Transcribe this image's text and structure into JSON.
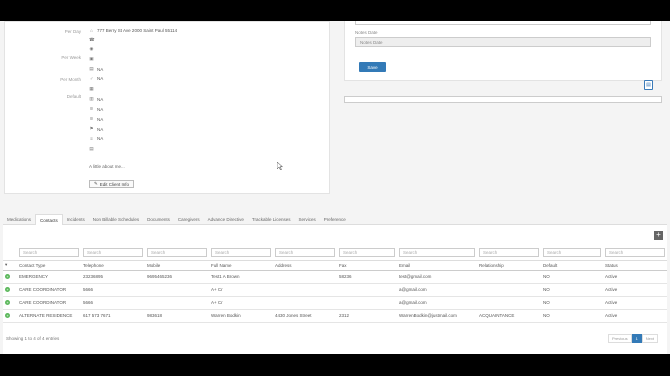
{
  "profile": {
    "labels": [
      "Per Day",
      "Per Week",
      "Per Month",
      "Default"
    ],
    "address": "777 Berry St Ave 2000 Saint Paul 55114",
    "values": [
      "NA",
      "NA",
      "NA",
      "NA",
      "NA",
      "NA",
      "NA"
    ],
    "link": "A little about me...",
    "edit_button": "Edit Client Info"
  },
  "notes": {
    "label": "Notes Date",
    "value": "Notes Date",
    "save_button": "Save"
  },
  "tabs": [
    "Medications",
    "Contacts",
    "Incidents",
    "Non Billable Schedules",
    "Documents",
    "Caregivers",
    "Advance Directive",
    "Trackable Licenses",
    "Services",
    "Preference"
  ],
  "table": {
    "search_placeholder": "Search",
    "columns": [
      "Contact Type",
      "Telephone",
      "Mobile",
      "Full Name",
      "Address",
      "Fax",
      "Email",
      "Relationship",
      "Default",
      "Status"
    ],
    "rows": [
      [
        "EMERGENCY",
        "23236895",
        "9695465236",
        "Test1 A Brown",
        "",
        "58236",
        "test@gmail.com",
        "",
        "NO",
        "Active"
      ],
      [
        "CARE COORDINATOR",
        "5666",
        "",
        "A+ Cr",
        "",
        "",
        "a@gmail.com",
        "",
        "NO",
        "Active"
      ],
      [
        "CARE COORDINATOR",
        "5666",
        "",
        "A+ Cr",
        "",
        "",
        "a@gmail.com",
        "",
        "NO",
        "Active"
      ],
      [
        "ALTERNATE RESIDENCE",
        "617 573 7671",
        "983618",
        "Warren Bodkin",
        "4430 Jones Street",
        "2312",
        "WarrenBodkin@justmail.com",
        "ACQUAINTANCE",
        "NO",
        "Active"
      ]
    ],
    "footer": "Showing 1 to 4 of 4 entries",
    "pager": [
      "Previous",
      "1",
      "Next"
    ]
  }
}
